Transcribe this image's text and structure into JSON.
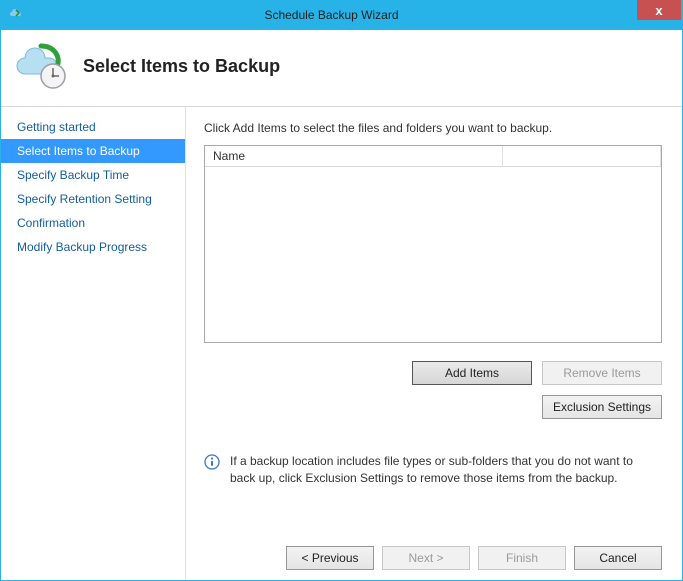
{
  "titlebar": {
    "title": "Schedule Backup Wizard",
    "close": "x"
  },
  "header": {
    "title": "Select Items to Backup"
  },
  "sidebar": {
    "items": [
      {
        "label": "Getting started",
        "selected": false
      },
      {
        "label": "Select Items to Backup",
        "selected": true
      },
      {
        "label": "Specify Backup Time",
        "selected": false
      },
      {
        "label": "Specify Retention Setting",
        "selected": false
      },
      {
        "label": "Confirmation",
        "selected": false
      },
      {
        "label": "Modify Backup Progress",
        "selected": false
      }
    ]
  },
  "main": {
    "instruction": "Click Add Items to select the files and folders you want to backup.",
    "columns": {
      "name": "Name"
    },
    "buttons": {
      "addItems": "Add Items",
      "removeItems": "Remove Items",
      "exclusionSettings": "Exclusion Settings"
    },
    "info": "If a backup location includes file types or sub-folders that you do not want to back up, click Exclusion Settings to remove those items from the backup."
  },
  "footer": {
    "previous": "< Previous",
    "next": "Next >",
    "finish": "Finish",
    "cancel": "Cancel"
  }
}
